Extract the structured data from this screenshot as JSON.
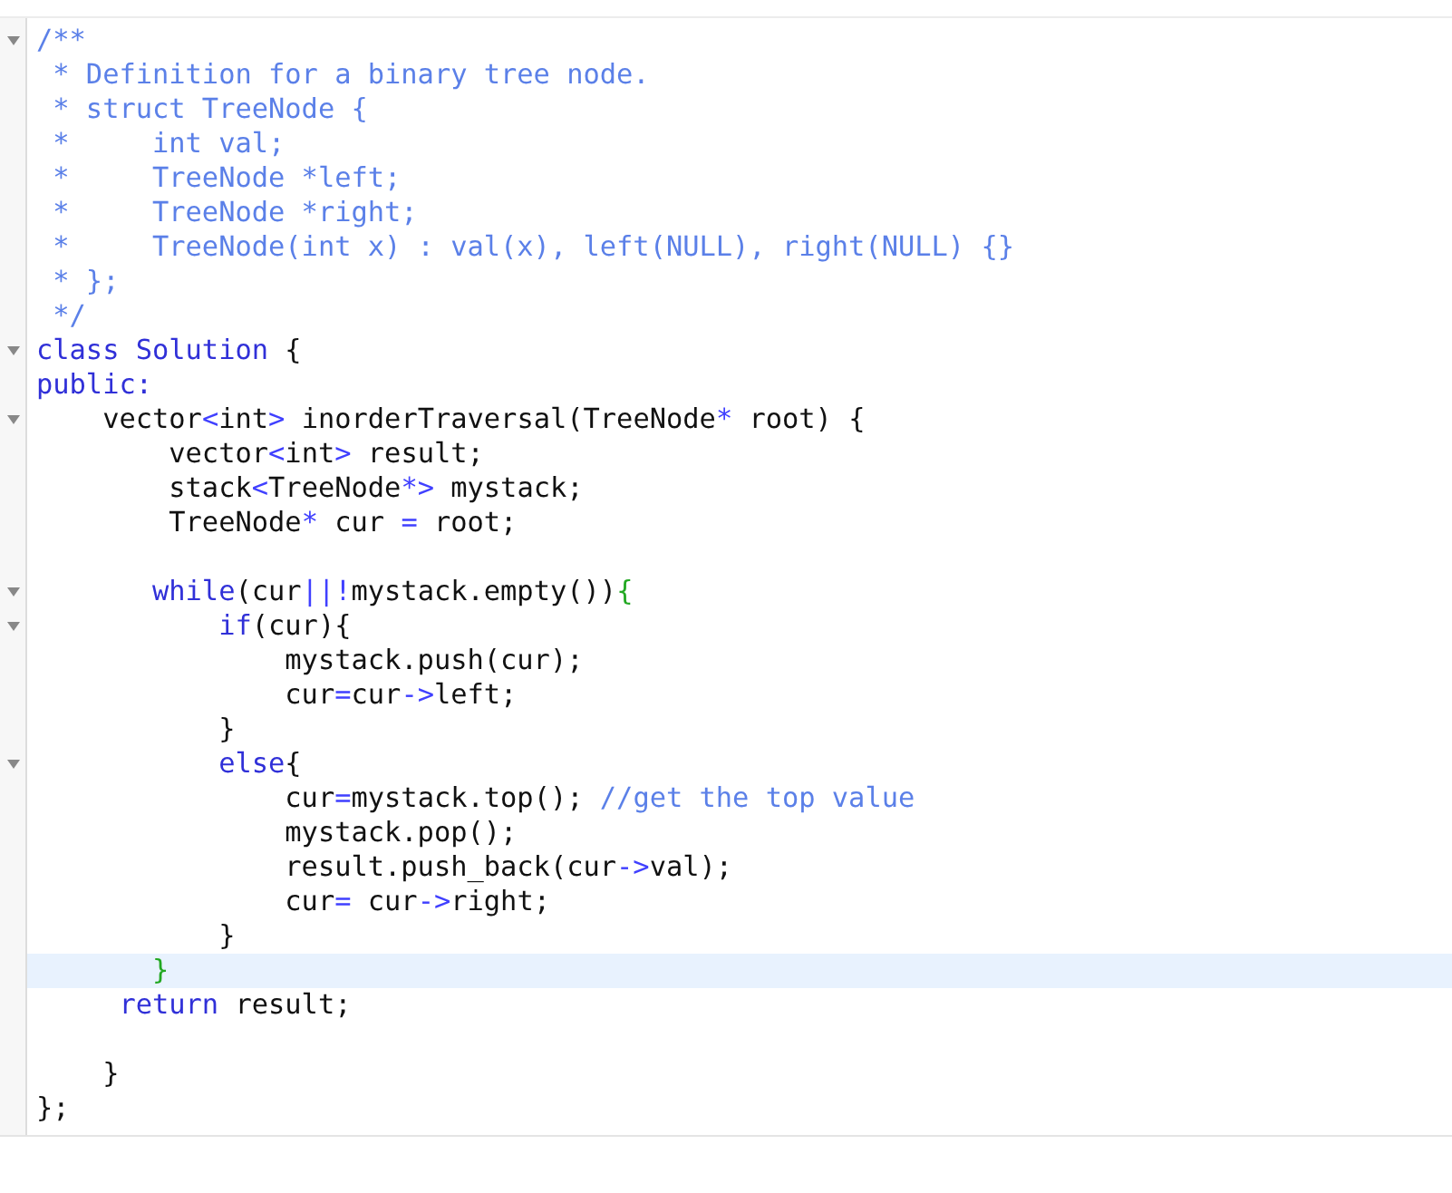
{
  "editor": {
    "lines": [
      {
        "fold": true,
        "highlighted": false,
        "tokens": [
          {
            "kind": "comment",
            "text": "/**"
          }
        ]
      },
      {
        "fold": false,
        "highlighted": false,
        "tokens": [
          {
            "kind": "comment",
            "text": " * Definition for a binary tree node."
          }
        ]
      },
      {
        "fold": false,
        "highlighted": false,
        "tokens": [
          {
            "kind": "comment",
            "text": " * struct TreeNode {"
          }
        ]
      },
      {
        "fold": false,
        "highlighted": false,
        "tokens": [
          {
            "kind": "comment",
            "text": " *     int val;"
          }
        ]
      },
      {
        "fold": false,
        "highlighted": false,
        "tokens": [
          {
            "kind": "comment",
            "text": " *     TreeNode *left;"
          }
        ]
      },
      {
        "fold": false,
        "highlighted": false,
        "tokens": [
          {
            "kind": "comment",
            "text": " *     TreeNode *right;"
          }
        ]
      },
      {
        "fold": false,
        "highlighted": false,
        "tokens": [
          {
            "kind": "comment",
            "text": " *     TreeNode(int x) : val(x), left(NULL), right(NULL) {}"
          }
        ]
      },
      {
        "fold": false,
        "highlighted": false,
        "tokens": [
          {
            "kind": "comment",
            "text": " * };"
          }
        ]
      },
      {
        "fold": false,
        "highlighted": false,
        "tokens": [
          {
            "kind": "comment",
            "text": " */"
          }
        ]
      },
      {
        "fold": true,
        "highlighted": false,
        "tokens": [
          {
            "kind": "keyword",
            "text": "class Solution"
          },
          {
            "kind": "text",
            "text": " {"
          }
        ]
      },
      {
        "fold": false,
        "highlighted": false,
        "tokens": [
          {
            "kind": "keyword",
            "text": "public:"
          }
        ]
      },
      {
        "fold": true,
        "highlighted": false,
        "tokens": [
          {
            "kind": "text",
            "text": "    vector"
          },
          {
            "kind": "operator",
            "text": "<"
          },
          {
            "kind": "text",
            "text": "int"
          },
          {
            "kind": "operator",
            "text": ">"
          },
          {
            "kind": "text",
            "text": " inorderTraversal(TreeNode"
          },
          {
            "kind": "operator",
            "text": "*"
          },
          {
            "kind": "text",
            "text": " root) {"
          }
        ]
      },
      {
        "fold": false,
        "highlighted": false,
        "tokens": [
          {
            "kind": "text",
            "text": "        vector"
          },
          {
            "kind": "operator",
            "text": "<"
          },
          {
            "kind": "text",
            "text": "int"
          },
          {
            "kind": "operator",
            "text": ">"
          },
          {
            "kind": "text",
            "text": " result;"
          }
        ]
      },
      {
        "fold": false,
        "highlighted": false,
        "tokens": [
          {
            "kind": "text",
            "text": "        stack"
          },
          {
            "kind": "operator",
            "text": "<"
          },
          {
            "kind": "text",
            "text": "TreeNode"
          },
          {
            "kind": "operator",
            "text": "*>"
          },
          {
            "kind": "text",
            "text": " mystack;"
          }
        ]
      },
      {
        "fold": false,
        "highlighted": false,
        "tokens": [
          {
            "kind": "text",
            "text": "        TreeNode"
          },
          {
            "kind": "operator",
            "text": "*"
          },
          {
            "kind": "text",
            "text": " cur "
          },
          {
            "kind": "operator",
            "text": "="
          },
          {
            "kind": "text",
            "text": " root;"
          }
        ]
      },
      {
        "fold": false,
        "highlighted": false
      },
      {
        "fold": true,
        "highlighted": false,
        "tokens": [
          {
            "kind": "keyword",
            "text": "       while"
          },
          {
            "kind": "text",
            "text": "(cur"
          },
          {
            "kind": "operator",
            "text": "||!"
          },
          {
            "kind": "text",
            "text": "mystack.empty())"
          },
          {
            "kind": "bracket",
            "text": "{"
          }
        ]
      },
      {
        "fold": true,
        "highlighted": false,
        "tokens": [
          {
            "kind": "keyword",
            "text": "           if"
          },
          {
            "kind": "text",
            "text": "(cur){"
          }
        ]
      },
      {
        "fold": false,
        "highlighted": false,
        "tokens": [
          {
            "kind": "text",
            "text": "               mystack.push(cur);"
          }
        ]
      },
      {
        "fold": false,
        "highlighted": false,
        "tokens": [
          {
            "kind": "text",
            "text": "               cur"
          },
          {
            "kind": "operator",
            "text": "="
          },
          {
            "kind": "text",
            "text": "cur"
          },
          {
            "kind": "operator",
            "text": "->"
          },
          {
            "kind": "text",
            "text": "left;"
          }
        ]
      },
      {
        "fold": false,
        "highlighted": false,
        "tokens": [
          {
            "kind": "text",
            "text": "           }"
          }
        ]
      },
      {
        "fold": true,
        "highlighted": false,
        "tokens": [
          {
            "kind": "keyword",
            "text": "           else"
          },
          {
            "kind": "text",
            "text": "{"
          }
        ]
      },
      {
        "fold": false,
        "highlighted": false,
        "tokens": [
          {
            "kind": "text",
            "text": "               cur"
          },
          {
            "kind": "operator",
            "text": "="
          },
          {
            "kind": "text",
            "text": "mystack.top(); "
          },
          {
            "kind": "comment",
            "text": "//get the top value"
          }
        ]
      },
      {
        "fold": false,
        "highlighted": false,
        "tokens": [
          {
            "kind": "text",
            "text": "               mystack.pop();"
          }
        ]
      },
      {
        "fold": false,
        "highlighted": false,
        "tokens": [
          {
            "kind": "text",
            "text": "               result.push_back(cur"
          },
          {
            "kind": "operator",
            "text": "->"
          },
          {
            "kind": "text",
            "text": "val);"
          }
        ]
      },
      {
        "fold": false,
        "highlighted": false,
        "tokens": [
          {
            "kind": "text",
            "text": "               cur"
          },
          {
            "kind": "operator",
            "text": "="
          },
          {
            "kind": "text",
            "text": " cur"
          },
          {
            "kind": "operator",
            "text": "->"
          },
          {
            "kind": "text",
            "text": "right;"
          }
        ]
      },
      {
        "fold": false,
        "highlighted": false,
        "tokens": [
          {
            "kind": "text",
            "text": "           }"
          }
        ]
      },
      {
        "fold": false,
        "highlighted": true,
        "tokens": [
          {
            "kind": "bracket",
            "text": "       }"
          }
        ]
      },
      {
        "fold": false,
        "highlighted": false,
        "tokens": [
          {
            "kind": "keyword",
            "text": "     return"
          },
          {
            "kind": "text",
            "text": " result;"
          }
        ]
      },
      {
        "fold": false,
        "highlighted": false
      },
      {
        "fold": false,
        "highlighted": false,
        "tokens": [
          {
            "kind": "text",
            "text": "    }"
          }
        ]
      },
      {
        "fold": false,
        "highlighted": false,
        "tokens": [
          {
            "kind": "text",
            "text": "};"
          }
        ]
      }
    ]
  }
}
